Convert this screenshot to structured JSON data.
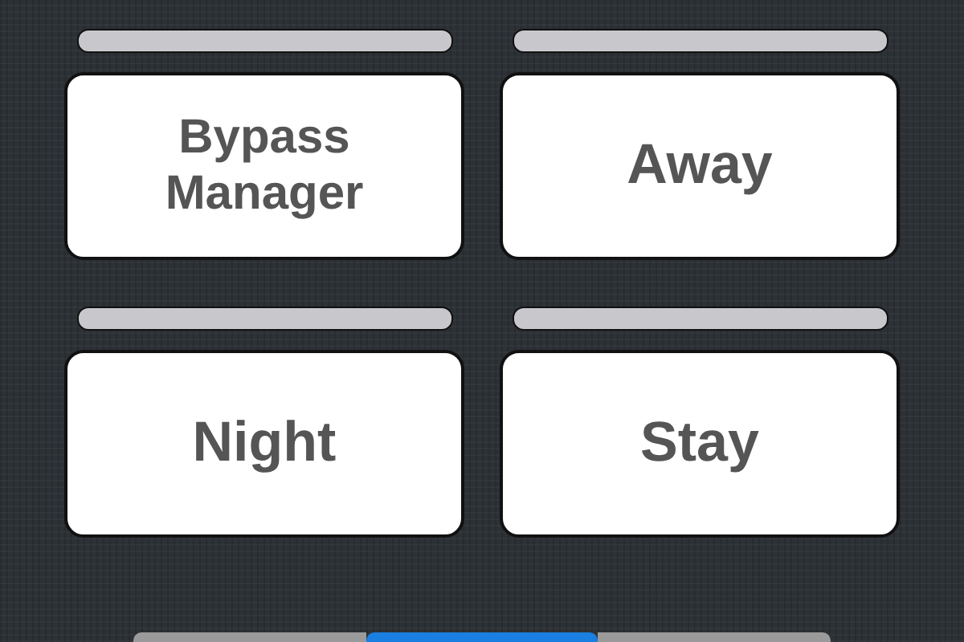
{
  "modes": [
    {
      "label": "Bypass Manager"
    },
    {
      "label": "Away"
    },
    {
      "label": "Night"
    },
    {
      "label": "Stay"
    }
  ],
  "segments": [
    {
      "selected": false
    },
    {
      "selected": true
    },
    {
      "selected": false
    }
  ]
}
